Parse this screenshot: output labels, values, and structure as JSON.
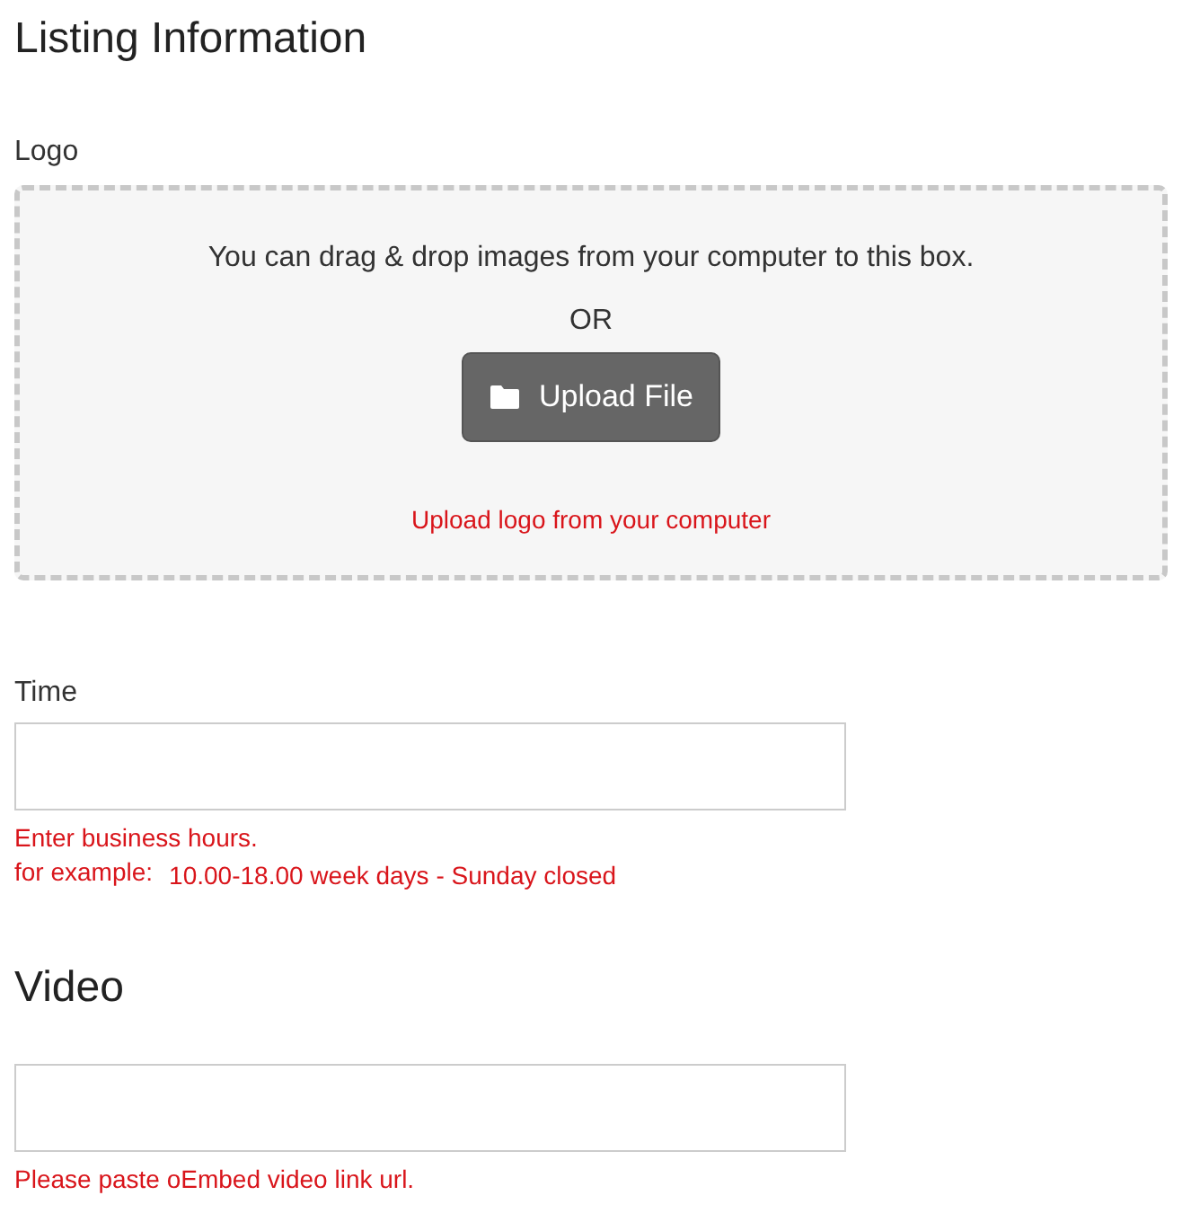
{
  "title": "Listing Information",
  "logo": {
    "label": "Logo",
    "drop_text": "You can drag & drop images from your computer to this box.",
    "or_text": "OR",
    "button": "Upload File",
    "hint": "Upload logo from your computer"
  },
  "time": {
    "label": "Time",
    "hint": "Enter business hours.",
    "example_label": "for example:",
    "example": "10.00-18.00 week days - Sunday closed"
  },
  "video": {
    "heading": "Video",
    "hint": "Please paste oEmbed video link url."
  }
}
